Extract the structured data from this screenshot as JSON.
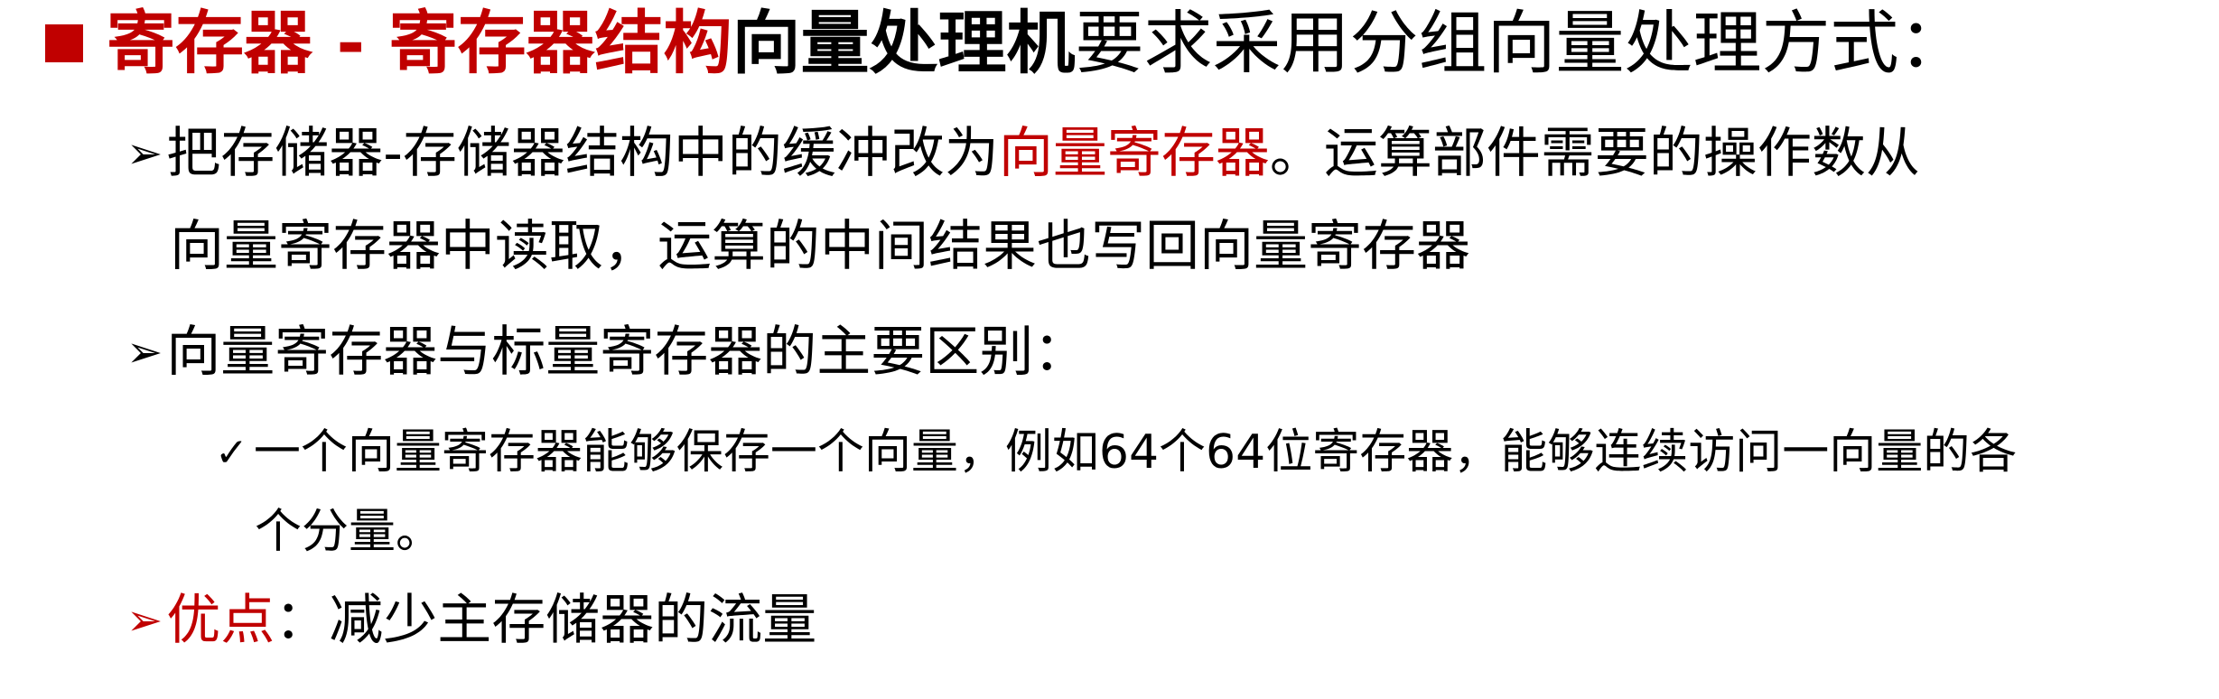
{
  "heading": {
    "part_red": "寄存器 - 寄存器结构",
    "part_bold": "向量处理机",
    "part_rest": "要求采用分组向量处理方式："
  },
  "bullets": {
    "b1": {
      "marker": "➢",
      "text_before": "把存储器-存储器结构中的缓冲改为",
      "text_red": "向量寄存器",
      "text_after_line1": "。运算部件需要的操作数从",
      "text_line2": "向量寄存器中读取，运算的中间结果也写回向量寄存器"
    },
    "b2": {
      "marker": "➢",
      "text": "向量寄存器与标量寄存器的主要区别："
    },
    "b2_sub": {
      "marker": "✓",
      "text_line1": "一个向量寄存器能够保存一个向量，例如64个64位寄存器，能够连续访问一向量的各",
      "text_line2": "个分量。"
    },
    "b3": {
      "marker": "➢",
      "label_red": "优点",
      "text": "：减少主存储器的流量"
    }
  },
  "colors": {
    "accent_red": "#c00000",
    "text": "#000000",
    "background": "#ffffff"
  }
}
